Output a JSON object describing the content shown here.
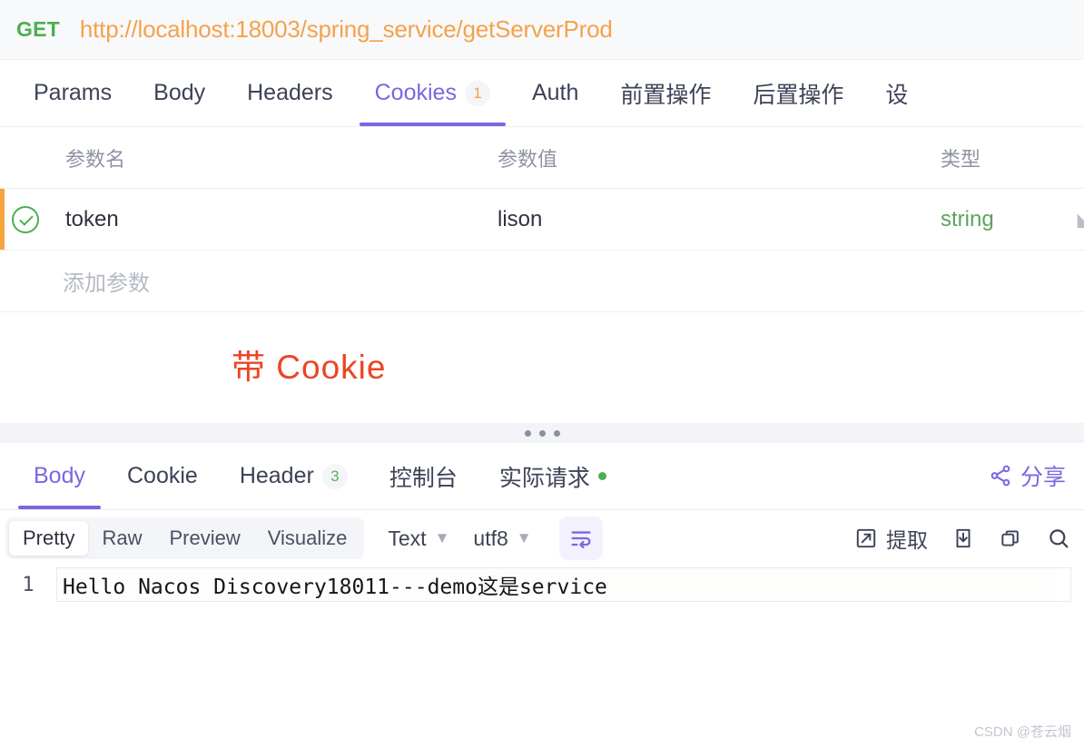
{
  "request": {
    "method": "GET",
    "url": "http://localhost:18003/spring_service/getServerProd",
    "tabs": [
      {
        "label": "Params",
        "badge": "",
        "active": false
      },
      {
        "label": "Body",
        "badge": "",
        "active": false
      },
      {
        "label": "Headers",
        "badge": "",
        "active": false
      },
      {
        "label": "Cookies",
        "badge": "1",
        "active": true
      },
      {
        "label": "Auth",
        "badge": "",
        "active": false
      },
      {
        "label": "前置操作",
        "badge": "",
        "active": false
      },
      {
        "label": "后置操作",
        "badge": "",
        "active": false
      },
      {
        "label": "设",
        "badge": "",
        "active": false
      }
    ],
    "table": {
      "headers": {
        "name": "参数名",
        "value": "参数值",
        "type": "类型"
      },
      "rows": [
        {
          "enabled": true,
          "name": "token",
          "value": "lison",
          "type": "string"
        }
      ],
      "add_placeholder": "添加参数"
    },
    "annotation": "带 Cookie"
  },
  "response": {
    "tabs": [
      {
        "label": "Body",
        "badge": "",
        "dot": false,
        "active": true
      },
      {
        "label": "Cookie",
        "badge": "",
        "dot": false,
        "active": false
      },
      {
        "label": "Header",
        "badge": "3",
        "dot": false,
        "active": false
      },
      {
        "label": "控制台",
        "badge": "",
        "dot": false,
        "active": false
      },
      {
        "label": "实际请求",
        "badge": "",
        "dot": true,
        "active": false
      }
    ],
    "share_label": "分享",
    "toolbar": {
      "views": [
        {
          "label": "Pretty",
          "active": true
        },
        {
          "label": "Raw",
          "active": false
        },
        {
          "label": "Preview",
          "active": false
        },
        {
          "label": "Visualize",
          "active": false
        }
      ],
      "format_select": "Text",
      "encoding_select": "utf8",
      "extract_label": "提取"
    },
    "body": {
      "lines": [
        {
          "number": "1",
          "text": "Hello Nacos Discovery18011---demo这是service"
        }
      ]
    }
  },
  "watermark": "CSDN @苍云烟",
  "colors": {
    "accent_purple": "#7a68e0",
    "method_green": "#4caf50",
    "url_orange": "#f5a24b",
    "annotation_red": "#ee4323",
    "type_green": "#5aa35f",
    "badge_orange": "#f0a13a"
  }
}
